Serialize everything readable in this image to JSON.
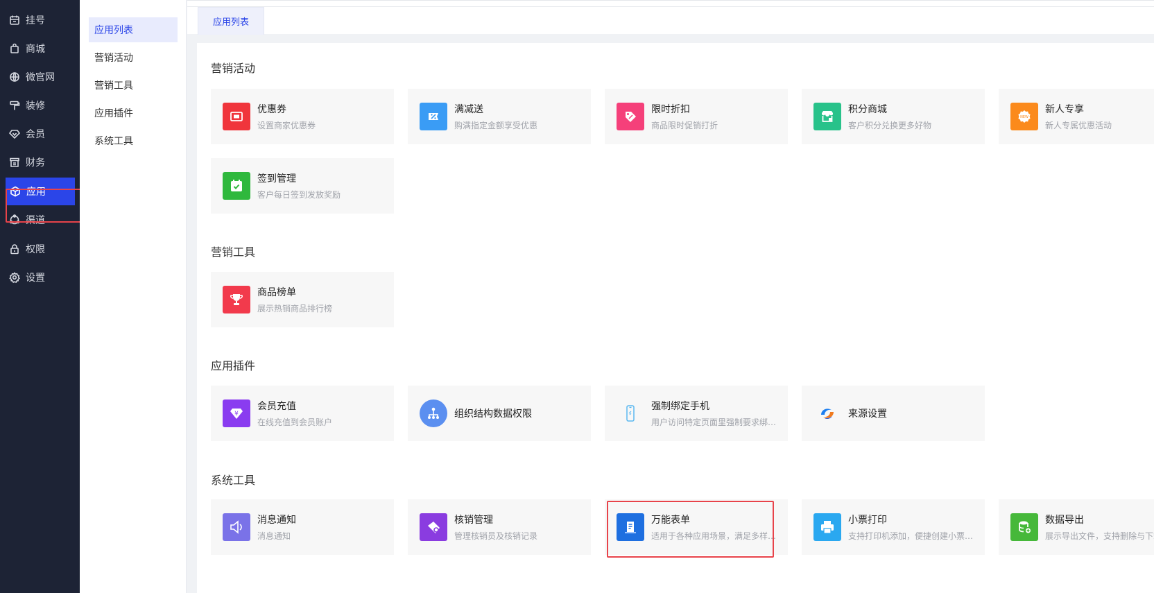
{
  "nav": {
    "items": [
      {
        "label": "挂号",
        "icon": "calendar-icon"
      },
      {
        "label": "商城",
        "icon": "shopping-bag-icon"
      },
      {
        "label": "微官网",
        "icon": "globe-icon"
      },
      {
        "label": "装修",
        "icon": "paint-roller-icon"
      },
      {
        "label": "会员",
        "icon": "diamond-icon"
      },
      {
        "label": "财务",
        "icon": "ledger-icon"
      },
      {
        "label": "应用",
        "icon": "cube-icon"
      },
      {
        "label": "渠道",
        "icon": "share-circle-icon"
      },
      {
        "label": "权限",
        "icon": "lock-icon"
      },
      {
        "label": "设置",
        "icon": "gear-icon"
      }
    ]
  },
  "submenu": {
    "items": [
      {
        "label": "应用列表"
      },
      {
        "label": "营销活动"
      },
      {
        "label": "营销工具"
      },
      {
        "label": "应用插件"
      },
      {
        "label": "系统工具"
      }
    ]
  },
  "tabs": {
    "active": "应用列表"
  },
  "sections": {
    "marketing_activity": {
      "title": "营销活动",
      "cards": [
        {
          "title": "优惠券",
          "desc": "设置商家优惠券",
          "icon": "coupon-icon",
          "color": "#f0353c"
        },
        {
          "title": "满减送",
          "desc": "购满指定金额享受优惠",
          "icon": "discount-ticket-icon",
          "color": "#3a9cf5"
        },
        {
          "title": "限时折扣",
          "desc": "商品限时促销打折",
          "icon": "price-tag-icon",
          "color": "#f5407a"
        },
        {
          "title": "积分商城",
          "desc": "客户积分兑换更多好物",
          "icon": "store-icon",
          "color": "#28c28a"
        },
        {
          "title": "新人专享",
          "desc": "新人专属优惠活动",
          "icon": "new-badge-icon",
          "color": "#fb8a1c"
        },
        {
          "title": "签到管理",
          "desc": "客户每日签到发放奖励",
          "icon": "checkin-calendar-icon",
          "color": "#2fb83d"
        }
      ]
    },
    "marketing_tools": {
      "title": "营销工具",
      "cards": [
        {
          "title": "商品榜单",
          "desc": "展示热销商品排行榜",
          "icon": "trophy-icon",
          "color": "#f23a4c"
        }
      ]
    },
    "plugins": {
      "title": "应用插件",
      "cards": [
        {
          "title": "会员充值",
          "desc": "在线充值到会员账户",
          "icon": "yuan-diamond-icon",
          "color": "#8a3cf0"
        },
        {
          "title": "组织结构数据权限",
          "desc": "",
          "icon": "org-tree-icon",
          "color": "#5b8ff0"
        },
        {
          "title": "强制绑定手机",
          "desc": "用户访问特定页面里强制要求绑定手机号",
          "icon": "mobile-phone-icon",
          "color": "#5bb8f0"
        },
        {
          "title": "来源设置",
          "desc": "",
          "icon": "swirl-logo-icon",
          "color": "#1e7ff0"
        }
      ]
    },
    "system_tools": {
      "title": "系统工具",
      "cards": [
        {
          "title": "消息通知",
          "desc": "消息通知",
          "icon": "speaker-icon",
          "color": "#7a72e8"
        },
        {
          "title": "核销管理",
          "desc": "管理核销员及核销记录",
          "icon": "verify-ticket-icon",
          "color": "#8a3ce0"
        },
        {
          "title": "万能表单",
          "desc": "适用于各种应用场景，满足多样化需求",
          "icon": "form-doc-icon",
          "color": "#1e6fe0"
        },
        {
          "title": "小票打印",
          "desc": "支持打印机添加，便捷创建小票打印模板",
          "icon": "printer-icon",
          "color": "#2aa8f0"
        },
        {
          "title": "数据导出",
          "desc": "展示导出文件，支持删除与下载",
          "icon": "database-export-icon",
          "color": "#46b83a"
        }
      ]
    }
  }
}
